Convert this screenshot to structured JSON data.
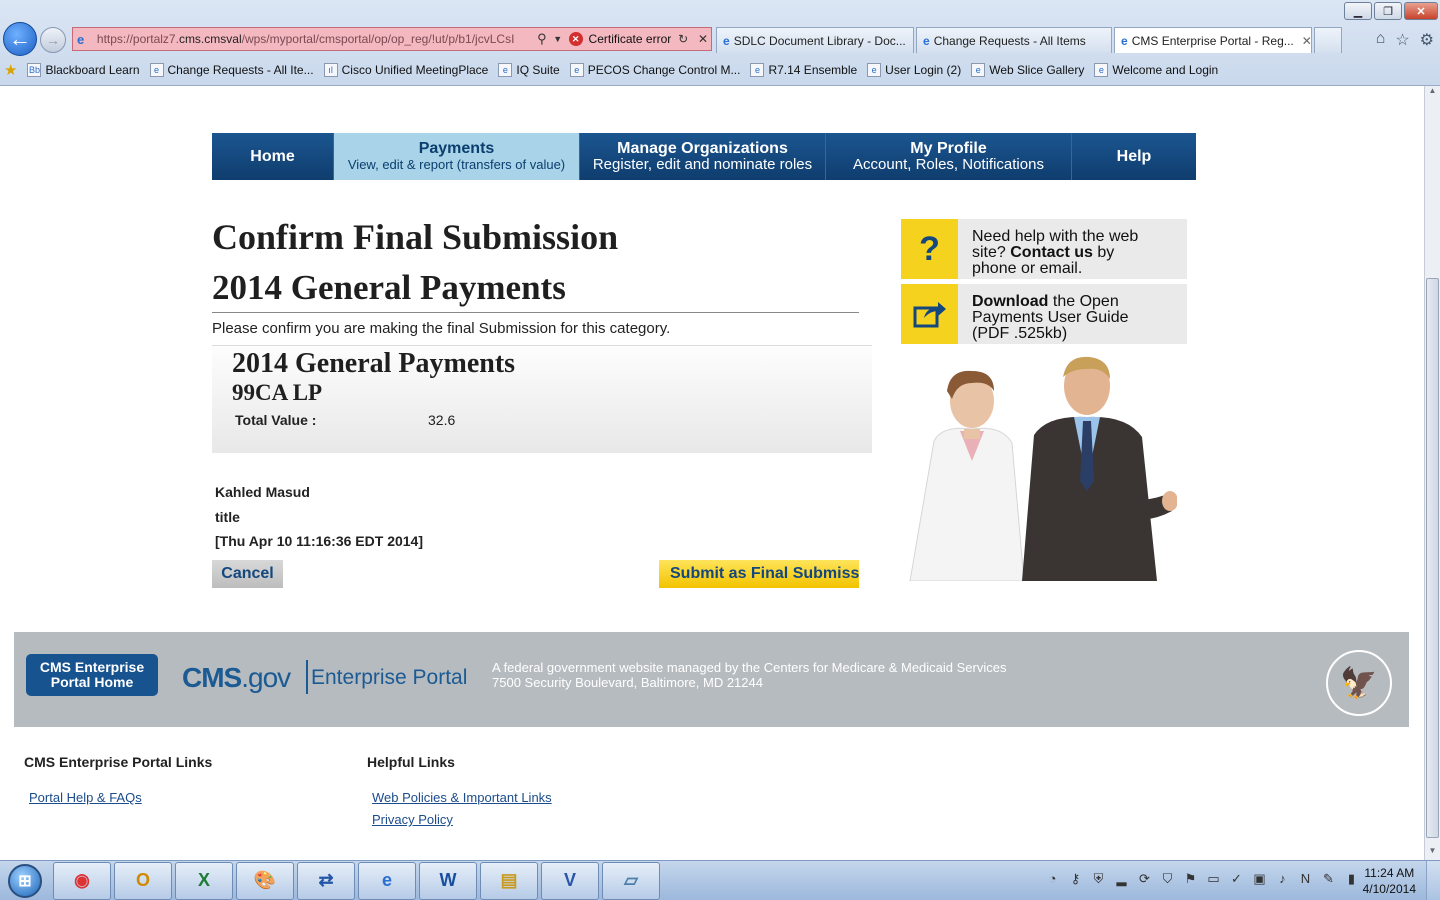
{
  "browser": {
    "address_url_gray": "https://portalz7.",
    "address_url_host": "cms.cmsval",
    "address_url_path": "/wps/myportal/cmsportal/op/op_reg/!ut/p/b1/jcvLCsI",
    "cert_error": "Certificate error",
    "tabs": [
      {
        "label": "SDLC Document Library - Doc..."
      },
      {
        "label": "Change Requests - All Items"
      },
      {
        "label": "CMS Enterprise Portal - Reg...",
        "active": true
      }
    ],
    "favorites": [
      "Blackboard Learn",
      "Change Requests - All Ite...",
      "Cisco Unified MeetingPlace",
      "IQ Suite",
      "PECOS Change Control M...",
      "R7.14 Ensemble",
      "User Login (2)",
      "Web Slice Gallery",
      "Welcome and Login"
    ]
  },
  "nav": {
    "home": "Home",
    "payments_title": "Payments",
    "payments_sub": "View, edit & report (transfers of value)",
    "orgs_title": "Manage Organizations",
    "orgs_sub": "Register, edit and nominate roles",
    "profile_title": "My Profile",
    "profile_sub": "Account, Roles, Notifications",
    "help": "Help"
  },
  "main": {
    "title": "Confirm Final Submission",
    "subtitle": "2014 General Payments",
    "confirm_text": "Please confirm you are making the final Submission for this category.",
    "summary_title": "2014 General Payments",
    "summary_org": "99CA LP",
    "total_label": "Total Value :",
    "total_value": "32.6",
    "signer_name": "Kahled Masud",
    "signer_title": "title",
    "signer_date": "[Thu Apr 10 11:16:36 EDT 2014]",
    "cancel_label": "Cancel",
    "submit_label": "Submit as Final Submissi"
  },
  "sidebar": {
    "help_pre": "Need help with the web site? ",
    "help_bold": "Contact us",
    "help_post": " by phone or email.",
    "guide_bold": "Download",
    "guide_post": " the Open Payments User Guide (PDF .525kb)"
  },
  "footer": {
    "home_button": "CMS Enterprise Portal Home",
    "logo_cms": "CMS",
    "logo_gov": ".gov",
    "logo_portal": "Enterprise Portal",
    "desc_line1": "A federal government website managed by the Centers for Medicare & Medicaid Services",
    "desc_line2": "7500 Security Boulevard, Baltimore, MD 21244"
  },
  "links": {
    "cms_heading": "CMS Enterprise Portal Links",
    "cms_items": [
      "Portal Help & FAQs"
    ],
    "help_heading": "Helpful Links",
    "help_items": [
      "Web Policies & Important Links",
      "Privacy Policy"
    ]
  },
  "taskbar": {
    "time": "11:24 AM",
    "date": "4/10/2014",
    "apps": [
      "chrome-icon",
      "outlook-icon",
      "excel-icon",
      "paint-icon",
      "remote-icon",
      "ie-icon",
      "word-icon",
      "explorer-icon",
      "visio-icon",
      "notepad-icon"
    ]
  },
  "colors": {
    "nav_blue": "#13477d",
    "nav_active": "#a8d3e8",
    "submit_yellow": "#f2c300",
    "footer_gray": "#b6bbc0"
  }
}
